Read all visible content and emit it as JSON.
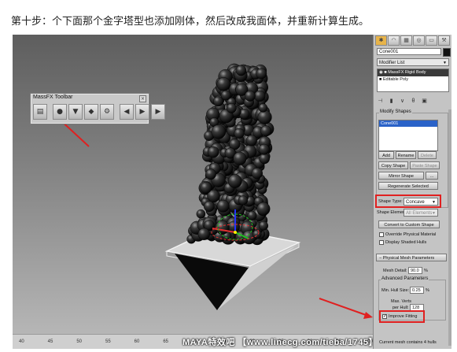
{
  "caption": "第十步：个下面那个金字塔型也添加刚体，然后改成我面体，并重新计算生成。",
  "watermark": "MAYA特效吧 【www.linecg.com/tieba/1745】",
  "toolbar": {
    "title": "MassFX Toolbar",
    "close_glyph": "×",
    "buttons": [
      "world-settings-icon",
      "rigid-body-icon",
      "cloth-icon",
      "constraint-icon",
      "tools-icon",
      "reset-sim-icon",
      "play-sim-icon",
      "step-sim-icon"
    ]
  },
  "timeline": {
    "ticks": [
      "40",
      "45",
      "50",
      "55",
      "60",
      "65",
      "70",
      "75",
      "80",
      "85",
      "90",
      "95",
      "100"
    ]
  },
  "colors": {
    "red_annotation": "#e02020",
    "viewport_top": "#5e5e5e",
    "viewport_bottom": "#b6b6b6",
    "panel_bg": "#c4c4c4",
    "active_tab": "#e8b44a"
  },
  "panel": {
    "tab_icons": [
      "create-tab-icon",
      "modify-tab-icon",
      "hierarchy-tab-icon",
      "motion-tab-icon",
      "display-tab-icon",
      "utilities-tab-icon"
    ],
    "object_name": "Cone001",
    "modifier_list": "Modifier List",
    "stack": [
      "MassFX Rigid Body",
      "Editable Poly"
    ],
    "modify_shapes": {
      "header": "Modify Shapes",
      "list_item": "Cone001",
      "add": "Add",
      "rename": "Rename",
      "delete": "Delete",
      "copy_shape": "Copy Shape",
      "paste_shape": "Paste Shape",
      "mirror_shape": "Mirror Shape",
      "mirror_more": "...",
      "regenerate": "Regenerate Selected",
      "shape_type_label": "Shape Type:",
      "shape_type_value": "Concave",
      "shape_element_label": "Shape Element:",
      "shape_element_value": "All Elements",
      "convert": "Convert to Custom Shape",
      "override": "Override Physical Material",
      "display_hulls": "Display Shaded Hulls"
    },
    "mesh_params": {
      "header": "Physical Mesh Parameters",
      "mesh_detail_label": "Mesh Detail:",
      "mesh_detail_value": "90.0",
      "mesh_detail_unit": "%",
      "advanced_header": "Advanced Parameters",
      "min_hull_label": "Min. Hull Size:",
      "min_hull_value": "0.25",
      "min_hull_unit": "%",
      "max_verts_label": "Max. Verts",
      "per_hull_label": "per Hull:",
      "per_hull_value": "128",
      "improve_fitting": "Improve Fitting",
      "improve_checked": "✓"
    },
    "status": "Current mesh contains 4 hulls"
  }
}
